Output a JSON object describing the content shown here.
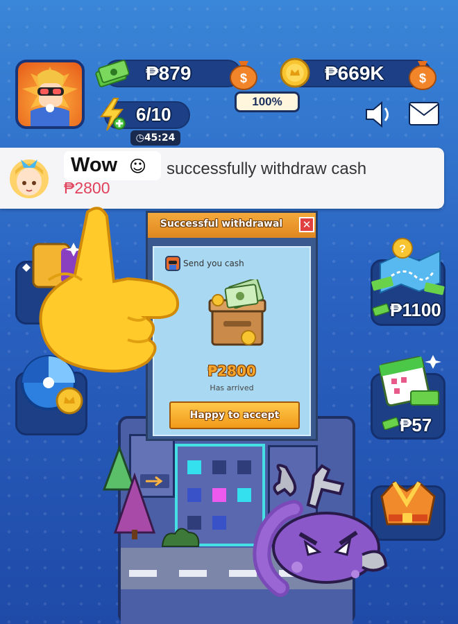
{
  "header": {
    "cash_balance": "₱879",
    "coin_balance": "₱669K",
    "cash_progress": "100%",
    "energy": "6/10",
    "energy_timer": "45:24"
  },
  "notification": {
    "exclaim": "Wow",
    "message": "successfully withdraw cash",
    "amount": "₱2800"
  },
  "side_buttons": {
    "map_reward": "₱1100",
    "calendar_reward": "₱57"
  },
  "dialog": {
    "title": "Successful withdrawal",
    "close": "✕",
    "sender": "Send you cash",
    "amount": "₱2800",
    "status": "Has arrived",
    "accept_label": "Happy to accept"
  },
  "colors": {
    "background": "#2a63c2",
    "dialog_header": "#e0871f",
    "accept_button": "#f19a1a",
    "notification_amount": "#e0405a"
  },
  "icons": [
    "cash-stack-icon",
    "money-bag-icon",
    "coin-icon",
    "energy-bolt-icon",
    "sound-icon",
    "mail-icon",
    "clock-icon",
    "treasure-chest-icon",
    "wrench-icon",
    "pointing-hand-icon"
  ]
}
